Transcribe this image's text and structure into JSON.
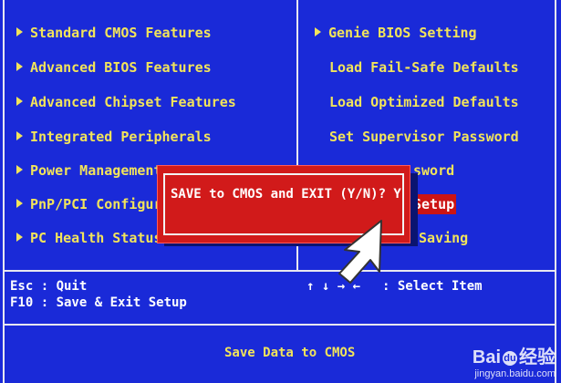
{
  "left_menu": [
    {
      "label": "Standard CMOS Features",
      "submenu": true
    },
    {
      "label": "Advanced BIOS Features",
      "submenu": true
    },
    {
      "label": "Advanced Chipset Features",
      "submenu": true
    },
    {
      "label": "Integrated Peripherals",
      "submenu": true
    },
    {
      "label": "Power Management",
      "submenu": true
    },
    {
      "label": "PnP/PCI Configura",
      "submenu": true
    },
    {
      "label": "PC Health Status",
      "submenu": true
    }
  ],
  "right_menu": [
    {
      "label": "Genie BIOS Setting",
      "submenu": true
    },
    {
      "label": "Load Fail-Safe Defaults",
      "submenu": false
    },
    {
      "label": "Load Optimized Defaults",
      "submenu": false
    },
    {
      "label": "Set Supervisor Password",
      "submenu": false
    },
    {
      "label": "sword",
      "submenu": false
    },
    {
      "label": "Setup",
      "submenu": false
    },
    {
      "label": "Saving",
      "submenu": false
    }
  ],
  "dialog": {
    "text": "SAVE to CMOS and EXIT (Y/N)? Y"
  },
  "footer": {
    "esc": "Esc : Quit",
    "f10": "F10 : Save & Exit Setup",
    "arrows": "↑ ↓ → ←",
    "select": ": Select Item"
  },
  "status": "Save Data to CMOS",
  "watermark": {
    "brand_a": "Bai",
    "brand_b": "经验",
    "url": "jingyan.baidu.com"
  },
  "colors": {
    "background": "#1a2ad8",
    "menu_text": "#f2e45a",
    "dialog": "#d11a1a",
    "border": "#e8e8f0"
  }
}
